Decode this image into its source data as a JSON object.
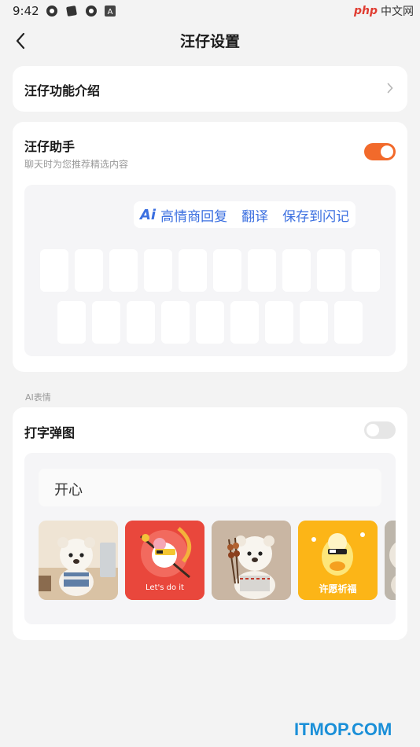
{
  "status": {
    "time": "9:42",
    "watermark_php": "php",
    "watermark_cn": "中文网"
  },
  "header": {
    "title": "汪仔设置"
  },
  "intro": {
    "label": "汪仔功能介绍"
  },
  "assistant": {
    "title": "汪仔助手",
    "subtitle": "聊天时为您推荐精选内容",
    "enabled": true,
    "ai_bar": {
      "logo": "Ai",
      "actions": [
        "高情商回复",
        "翻译",
        "保存到闪记"
      ]
    }
  },
  "ai_section": {
    "label": "AI表情"
  },
  "typing": {
    "title": "打字弹图",
    "enabled": false,
    "input_value": "开心",
    "stickers": [
      {
        "name": "bear-desk-sticker",
        "caption": ""
      },
      {
        "name": "lets-do-it-sticker",
        "caption": "Let's do it"
      },
      {
        "name": "bear-skewers-sticker",
        "caption": ""
      },
      {
        "name": "yellow-blessing-sticker",
        "caption": "许愿祈福"
      },
      {
        "name": "bear-partial-sticker",
        "caption": ""
      }
    ]
  },
  "footer": {
    "watermark": "ITMOP.COM"
  },
  "colors": {
    "accent": "#f26a2b",
    "ai_blue": "#3b6fe0",
    "background": "#f3f3f3",
    "watermark_blue": "#1a8fd8"
  },
  "icons": [
    "back-chevron-icon",
    "chevron-right-icon",
    "ai-logo-icon"
  ]
}
